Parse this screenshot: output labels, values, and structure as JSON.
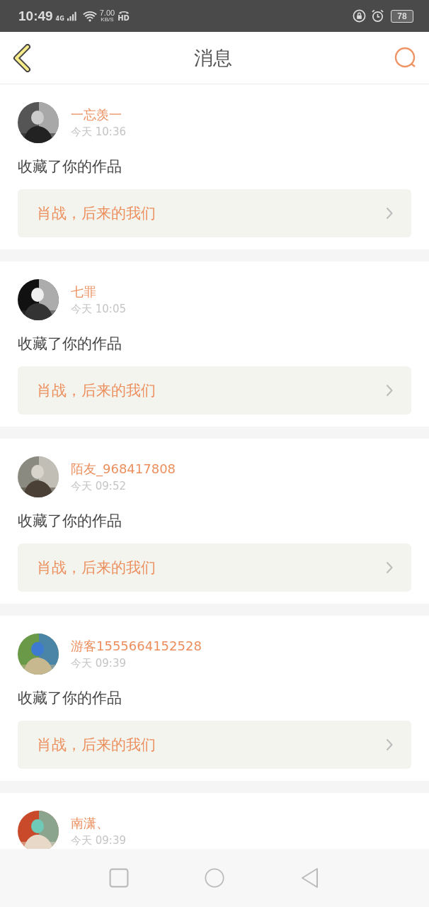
{
  "status_bar": {
    "time": "10:49",
    "network": "4G",
    "speed": "7.00",
    "speed_unit": "KB/S",
    "hd": "HD",
    "battery": "78"
  },
  "header": {
    "title": "消息"
  },
  "messages": [
    {
      "user": "一忘羡一",
      "time": "今天 10:36",
      "action": "收藏了你的作品",
      "work": "肖战，后来的我们"
    },
    {
      "user": "七罪",
      "time": "今天 10:05",
      "action": "收藏了你的作品",
      "work": "肖战，后来的我们"
    },
    {
      "user": "陌友_968417808",
      "time": "今天 09:52",
      "action": "收藏了你的作品",
      "work": "肖战，后来的我们"
    },
    {
      "user": "游客1555664152528",
      "time": "今天 09:39",
      "action": "收藏了你的作品",
      "work": "肖战，后来的我们"
    },
    {
      "user": "南潇、",
      "time": "今天 09:39"
    }
  ]
}
